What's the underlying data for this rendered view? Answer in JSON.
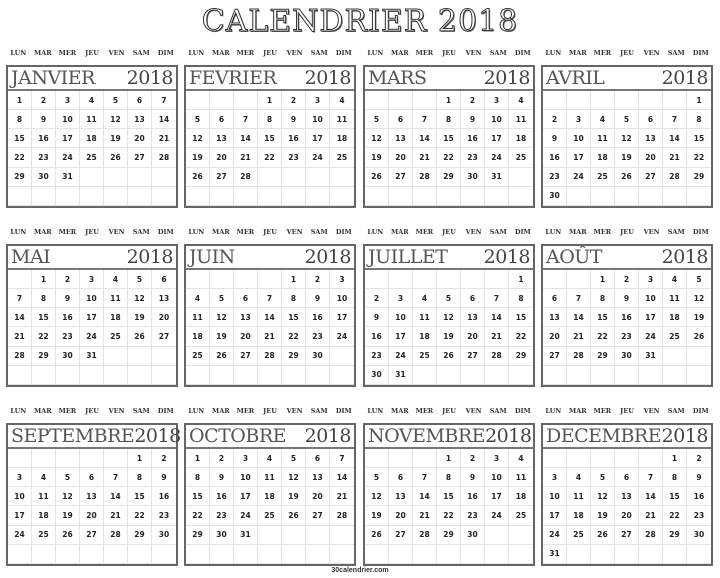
{
  "title": "CALENDRIER 2018",
  "year": "2018",
  "weekdays": [
    "LUN",
    "MAR",
    "MER",
    "JEU",
    "VEN",
    "SAM",
    "DIM"
  ],
  "months": [
    {
      "name": "JANVIER",
      "offset": 0,
      "days": 31
    },
    {
      "name": "FEVRIER",
      "offset": 3,
      "days": 28
    },
    {
      "name": "MARS",
      "offset": 3,
      "days": 31
    },
    {
      "name": "AVRIL",
      "offset": 6,
      "days": 30
    },
    {
      "name": "MAI",
      "offset": 1,
      "days": 31
    },
    {
      "name": "JUIN",
      "offset": 4,
      "days": 30
    },
    {
      "name": "JUILLET",
      "offset": 6,
      "days": 31
    },
    {
      "name": "AOÛT",
      "offset": 2,
      "days": 31
    },
    {
      "name": "SEPTEMBRE",
      "offset": 5,
      "days": 30
    },
    {
      "name": "OCTOBRE",
      "offset": 0,
      "days": 31
    },
    {
      "name": "NOVEMBRE",
      "offset": 3,
      "days": 30
    },
    {
      "name": "DECEMBRE",
      "offset": 5,
      "days": 31
    }
  ],
  "footer": "30calendrier.com"
}
